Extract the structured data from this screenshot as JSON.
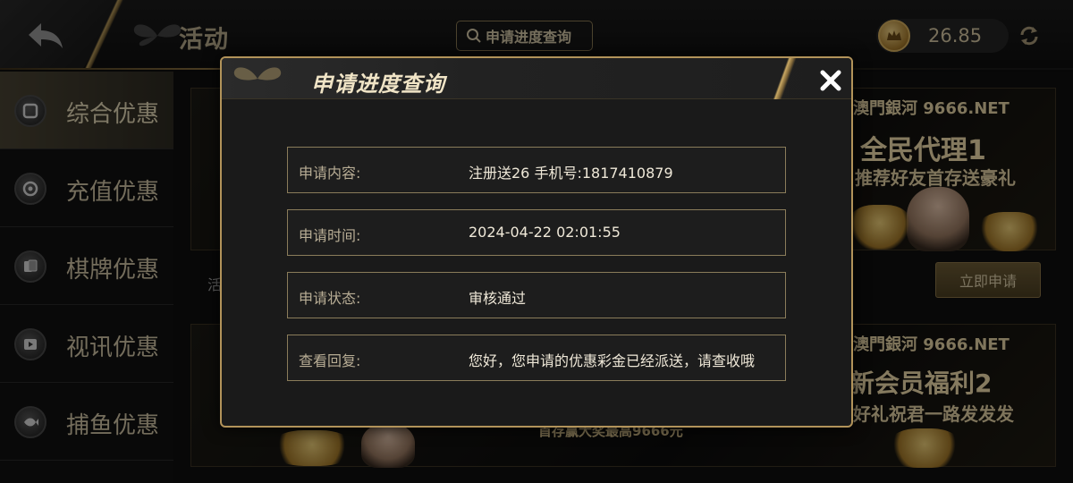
{
  "header": {
    "title": "活动",
    "query_button": "申请进度查询",
    "balance": "26.85"
  },
  "sidebar": {
    "items": [
      {
        "label": "综合优惠",
        "active": true
      },
      {
        "label": "充值优惠"
      },
      {
        "label": "棋牌优惠"
      },
      {
        "label": "视讯优惠"
      },
      {
        "label": "捕鱼优惠"
      }
    ]
  },
  "background": {
    "activity_label": "活",
    "apply_button": "立即申请",
    "banner1": {
      "brand": "澳門銀河 9666.NET",
      "headline": "全民代理1",
      "sub": "推荐好友首存送豪礼"
    },
    "banner2": {
      "brand": "澳門銀河 9666.NET",
      "headline": "新会员福利2",
      "sub": "好礼祝君一路发发发"
    },
    "banner3_sub": "首存赢大奖最高9666元"
  },
  "modal": {
    "title": "申请进度查询",
    "rows": [
      {
        "label": "申请内容:",
        "value": "注册送26 手机号:1817410879"
      },
      {
        "label": "申请时间:",
        "value": "2024-04-22 02:01:55"
      },
      {
        "label": "申请状态:",
        "value": "审核通过"
      },
      {
        "label": "查看回复:",
        "value": "您好，您申请的优惠彩金已经派送，请查收哦"
      }
    ]
  },
  "colors": {
    "accent_gold": "#b2935a",
    "bg_dark": "#1a1a1a"
  }
}
